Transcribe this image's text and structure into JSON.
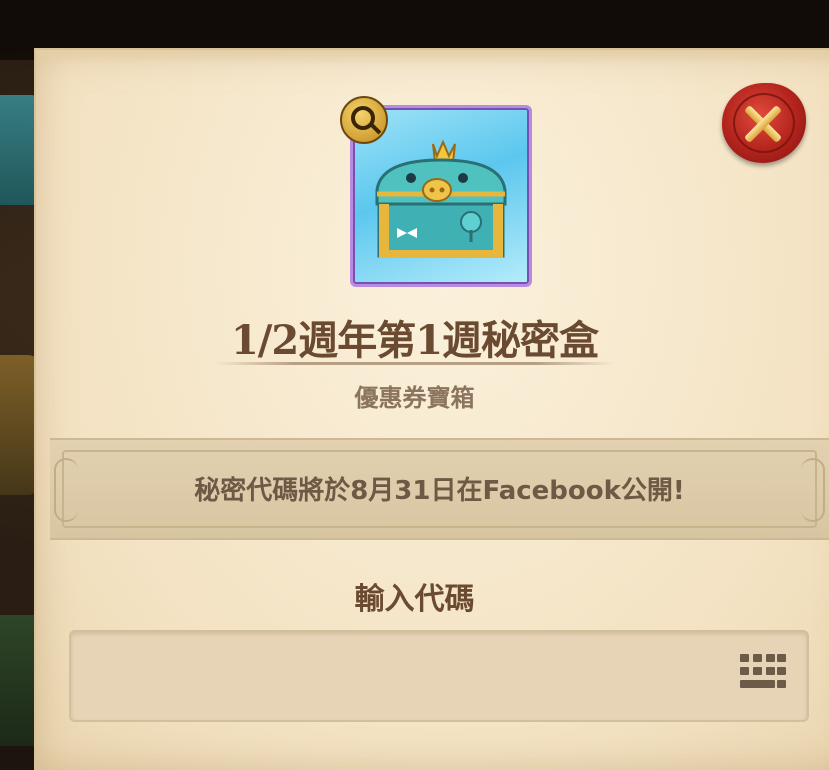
{
  "item": {
    "title": "1/2週年第1週秘密盒",
    "subtitle": "優惠券寶箱",
    "icon": "treasure-chest-icon",
    "frame_color": "#b68be0"
  },
  "notice": {
    "text": "秘密代碼將於8月31日在Facebook公開!"
  },
  "code_entry": {
    "label": "輸入代碼",
    "value": "",
    "placeholder": ""
  },
  "icons": {
    "zoom": "magnifier-icon",
    "close": "close-icon",
    "keyboard": "keyboard-icon"
  },
  "colors": {
    "title": "#6b4a32",
    "seal": "#b2231c",
    "parchment": "#f3e2c2"
  }
}
